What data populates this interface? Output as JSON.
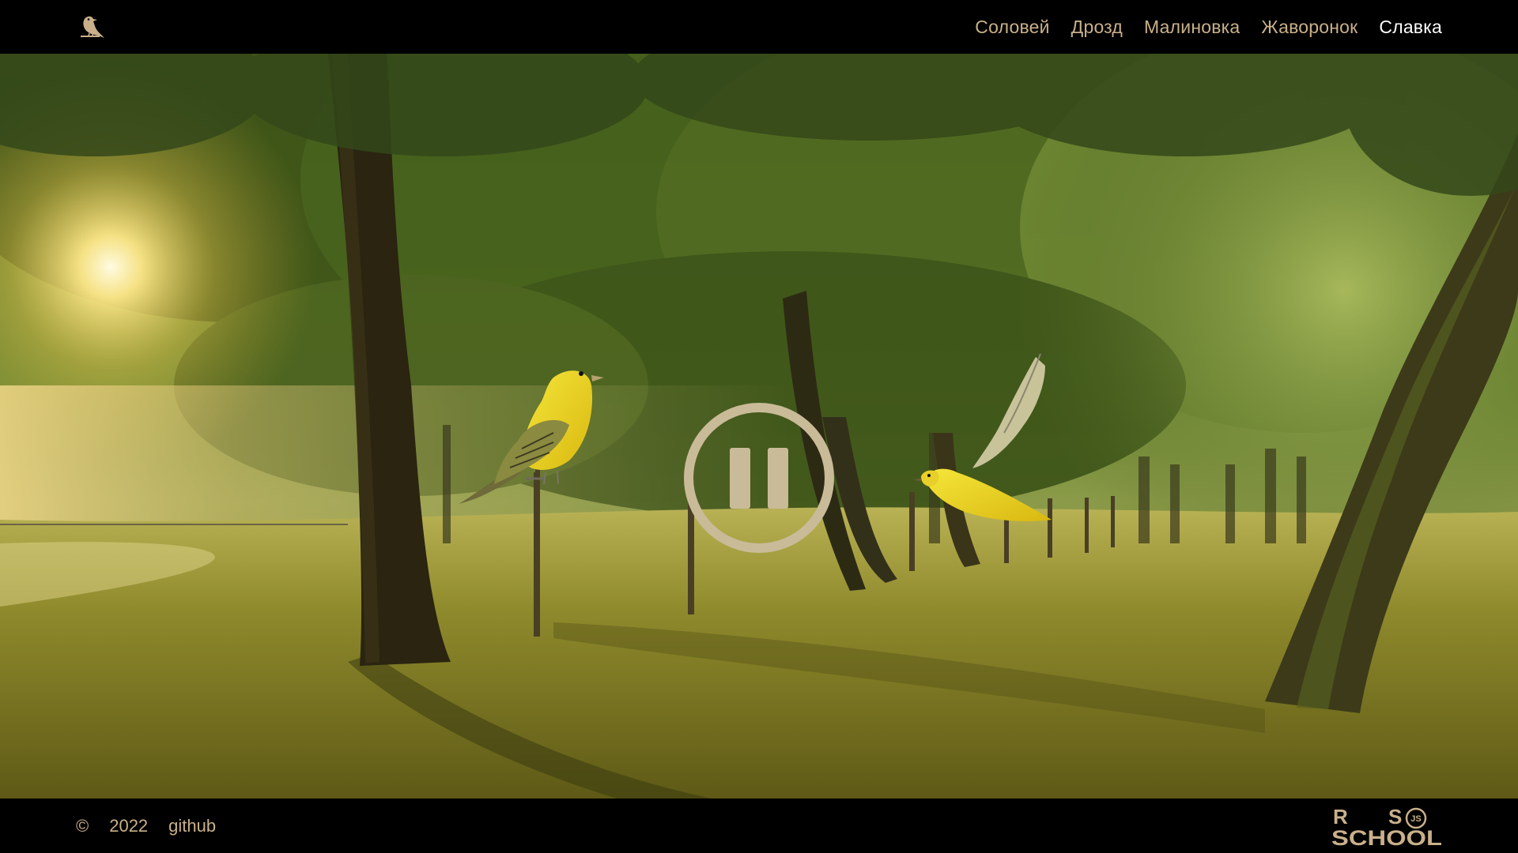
{
  "header": {
    "logo_icon": "bird-logo-icon",
    "nav": [
      {
        "label": "Соловей",
        "active": false
      },
      {
        "label": "Дрозд",
        "active": false
      },
      {
        "label": "Малиновка",
        "active": false
      },
      {
        "label": "Жаворонок",
        "active": false
      },
      {
        "label": "Славка",
        "active": true
      }
    ]
  },
  "main": {
    "player_state": "playing",
    "control_icon": "pause-icon"
  },
  "footer": {
    "copyright_symbol": "©",
    "year": "2022",
    "github_link": "github",
    "school_logo": {
      "top_left": "R",
      "top_right": "S",
      "badge": "JS",
      "bottom": "SCHOOL"
    }
  },
  "colors": {
    "accent": "#c9b08a",
    "active_nav": "#ffffff",
    "control": "#c9bb98",
    "bar_background": "#000000"
  }
}
